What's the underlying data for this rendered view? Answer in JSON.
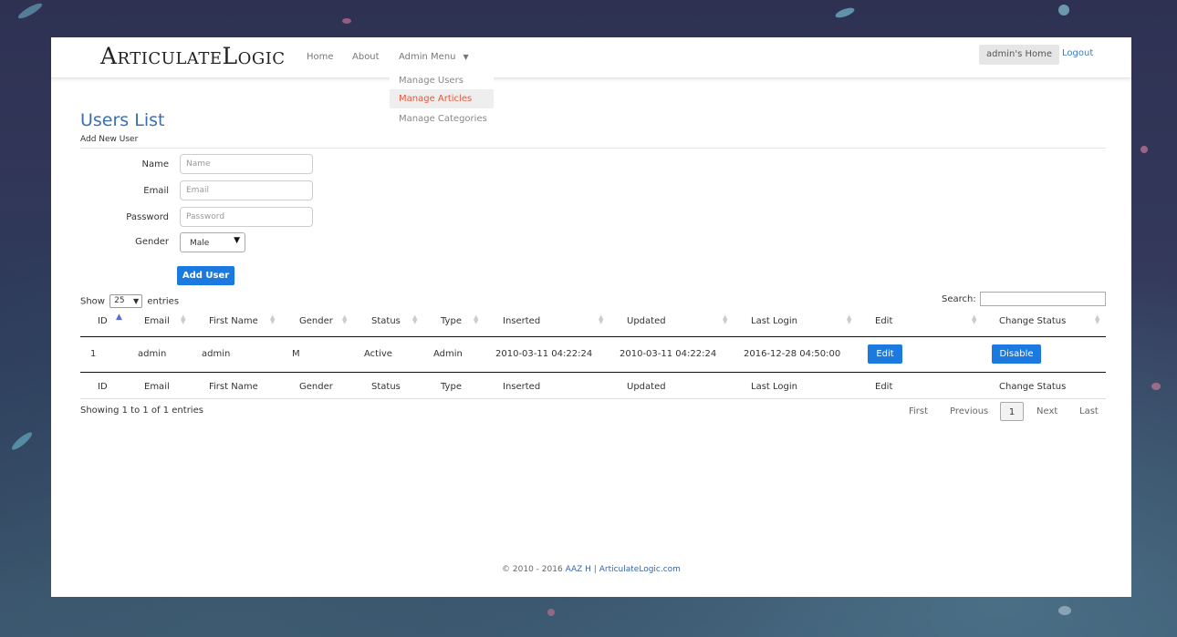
{
  "header": {
    "logo": "ArticulateLogic",
    "nav": {
      "home": "Home",
      "about": "About",
      "admin_menu": "Admin Menu"
    },
    "admin_dropdown": [
      "Manage Users",
      "Manage Articles",
      "Manage Categories"
    ],
    "admin_home": "admin's Home",
    "logout": "Logout"
  },
  "page": {
    "title": "Users List",
    "subtitle": "Add New User"
  },
  "form": {
    "name_label": "Name",
    "name_placeholder": "Name",
    "email_label": "Email",
    "email_placeholder": "Email",
    "password_label": "Password",
    "password_placeholder": "Password",
    "gender_label": "Gender",
    "gender_value": "Male",
    "submit": "Add User"
  },
  "table": {
    "show_label": "Show",
    "length_value": "25",
    "entries_label": "entries",
    "search_label": "Search:",
    "columns": [
      "ID",
      "Email",
      "First Name",
      "Gender",
      "Status",
      "Type",
      "Inserted",
      "Updated",
      "Last Login",
      "Edit",
      "Change Status"
    ],
    "row": {
      "id": "1",
      "email": "admin",
      "first_name": "admin",
      "gender": "M",
      "status": "Active",
      "type": "Admin",
      "inserted": "2010-03-11 04:22:24",
      "updated": "2010-03-11 04:22:24",
      "last_login": "2016-12-28 04:50:00",
      "edit": "Edit",
      "change_status": "Disable"
    },
    "info": "Showing 1 to 1 of 1 entries",
    "pagination": {
      "first": "First",
      "previous": "Previous",
      "current": "1",
      "next": "Next",
      "last": "Last"
    }
  },
  "footer": {
    "copyright": "© 2010 - 2016",
    "author": "AAZ H",
    "separator": "|",
    "site": "ArticulateLogic.com"
  },
  "colors": {
    "accent": "#1a7ae0",
    "link": "#3a7bc8",
    "title": "#3c6fb1",
    "active_menu": "#e05a3f"
  }
}
